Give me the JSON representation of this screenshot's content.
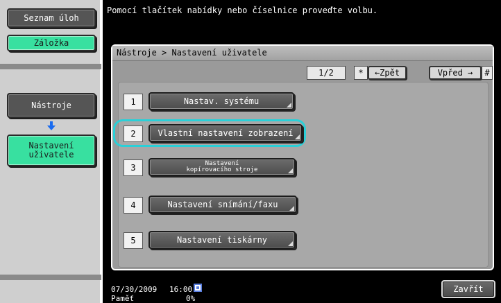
{
  "sidebar": {
    "job_list_label": "Seznam úloh",
    "bookmark_label": "Záložka",
    "tools_label": "Nástroje",
    "user_settings_label": "Nastavení\nuživatele"
  },
  "header": {
    "instruction": "Pomocí tlačítek nabídky nebo číselnice proveďte volbu."
  },
  "panel": {
    "breadcrumb": "Nástroje > Nastavení uživatele",
    "page_indicator": "1/2",
    "star_key": "*",
    "back_label": "←Zpět",
    "forward_label": "Vpřed →",
    "hash_key": "#"
  },
  "menu": {
    "items": [
      {
        "num": "1",
        "label": "Nastav. systému"
      },
      {
        "num": "2",
        "label": "Vlastní nastavení zobrazení"
      },
      {
        "num": "3",
        "label": "Nastavení\nkopírovacího stroje"
      },
      {
        "num": "4",
        "label": "Nastavení snímání/faxu"
      },
      {
        "num": "5",
        "label": "Nastavení tiskárny"
      }
    ],
    "highlighted_index": 2
  },
  "status": {
    "date": "07/30/2009",
    "time": "16:00",
    "memory_label": "Paměť",
    "memory_value": "0%",
    "network_icon": "network-icon"
  },
  "footer": {
    "close_label": "Zavřít"
  }
}
